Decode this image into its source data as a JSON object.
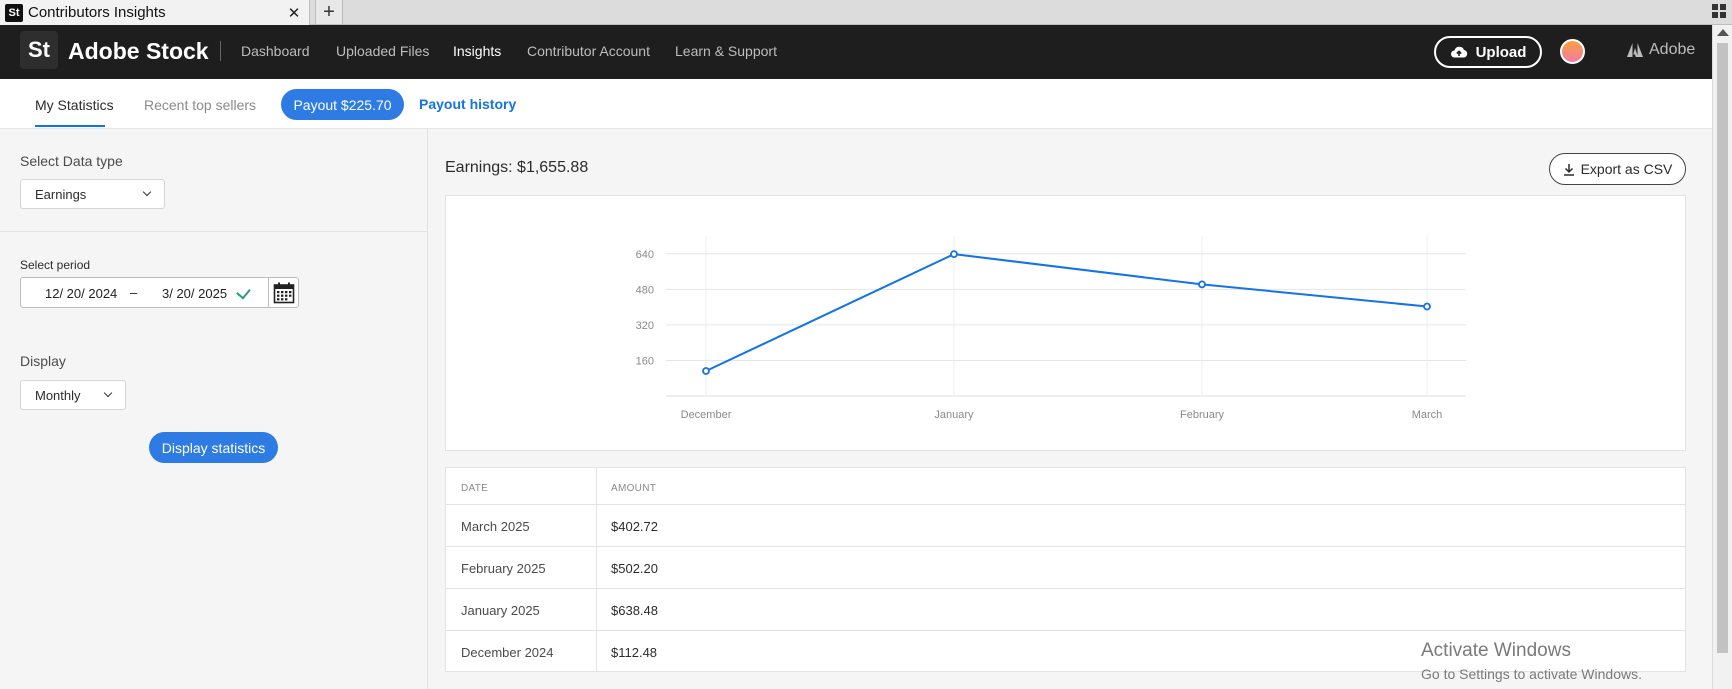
{
  "browser": {
    "tab_title": "Contributors Insights",
    "favicon_text": "St",
    "close_glyph": "✕",
    "newtab_glyph": "+"
  },
  "topnav": {
    "logo": "St",
    "brand": "Adobe Stock",
    "items": [
      "Dashboard",
      "Uploaded Files",
      "Insights",
      "Contributor Account",
      "Learn & Support"
    ],
    "active": "Insights",
    "upload_label": "Upload",
    "adobe_label": "Adobe"
  },
  "subnav": {
    "tabs": [
      "My Statistics",
      "Recent top sellers"
    ],
    "active": "My Statistics",
    "payout_label": "Payout $225.70",
    "payout_history_label": "Payout history"
  },
  "filters": {
    "data_type_label": "Select Data type",
    "data_type_value": "Earnings",
    "period_label": "Select period",
    "date_from": "12/ 20/ 2024",
    "date_separator": "–",
    "date_to": "3/ 20/ 2025",
    "display_label": "Display",
    "display_value": "Monthly",
    "display_button": "Display statistics"
  },
  "main": {
    "earnings_title": "Earnings: $1,655.88",
    "export_label": "Export as CSV"
  },
  "chart_data": {
    "type": "line",
    "categories": [
      "December",
      "January",
      "February",
      "March"
    ],
    "values": [
      112.48,
      638.48,
      502.2,
      402.72
    ],
    "title": "",
    "xlabel": "",
    "ylabel": "",
    "ylim": [
      0,
      720
    ],
    "yticks": [
      160,
      320,
      480,
      640
    ],
    "grid": true,
    "series_color": "#1473e6"
  },
  "table": {
    "headers": [
      "DATE",
      "AMOUNT"
    ],
    "rows": [
      {
        "date": "March 2025",
        "amount": "$402.72"
      },
      {
        "date": "February 2025",
        "amount": "$502.20"
      },
      {
        "date": "January 2025",
        "amount": "$638.48"
      },
      {
        "date": "December 2024",
        "amount": "$112.48"
      }
    ]
  },
  "watermark": {
    "activate_title": "Activate Windows",
    "activate_sub": "Go to Settings to activate Windows."
  },
  "colors": {
    "accent": "#2d7be3",
    "nav_bg": "#1e1e1e",
    "success": "#2d9d78"
  }
}
